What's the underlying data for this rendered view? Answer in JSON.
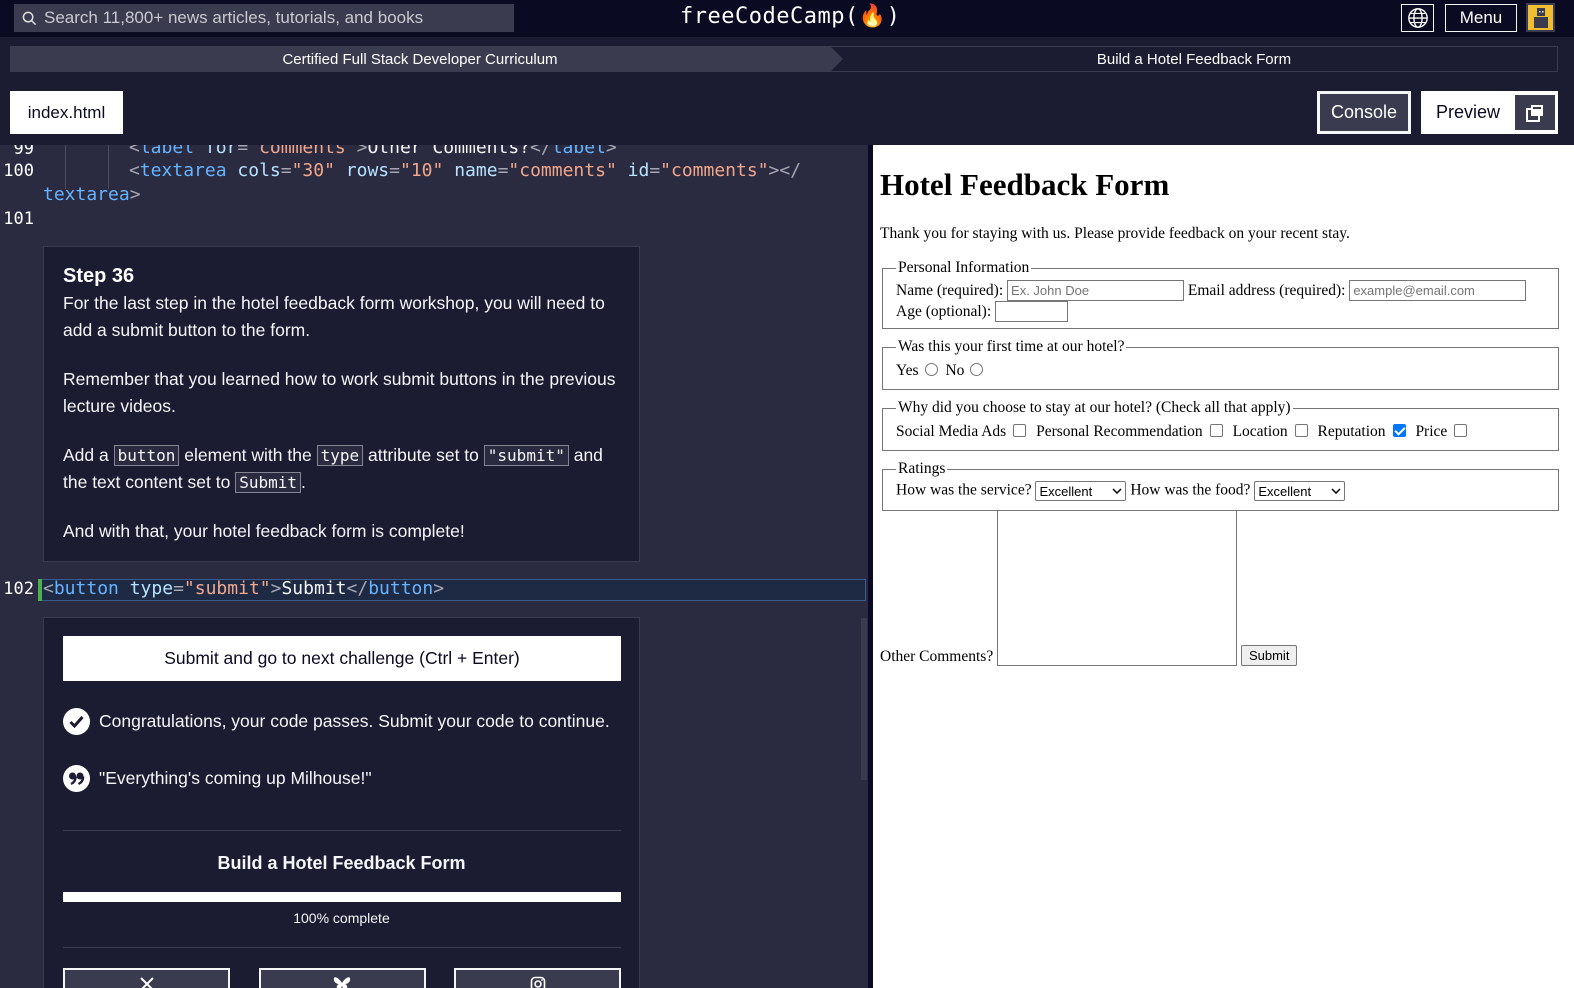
{
  "nav": {
    "search_placeholder": "Search 11,800+ news articles, tutorials, and books",
    "logo": "freeCodeCamp(🔥)",
    "menu_label": "Menu"
  },
  "breadcrumb": {
    "curriculum": "Certified Full Stack Developer Curriculum",
    "project": "Build a Hotel Feedback Form"
  },
  "tabs": {
    "file": "index.html",
    "console": "Console",
    "preview": "Preview"
  },
  "editor": {
    "line_numbers": [
      "99",
      "100",
      "101",
      "102"
    ],
    "step": {
      "title": "Step 36",
      "p1": "For the last step in the hotel feedback form workshop, you will need to add a submit button to the form.",
      "p2": "Remember that you learned how to work submit buttons in the previous lecture videos.",
      "p3_a": "Add a",
      "p3_code1": "button",
      "p3_b": "element with the",
      "p3_code2": "type",
      "p3_c": "attribute set to",
      "p3_code3": "\"submit\"",
      "p3_d": "and the text content set to",
      "p3_code4": "Submit",
      "p3_e": ".",
      "p4": "And with that, your hotel feedback form is complete!"
    },
    "result": {
      "submit_label": "Submit and go to next challenge (Ctrl + Enter)",
      "pass_msg": "Congratulations, your code passes. Submit your code to continue.",
      "quote": "\"Everything's coming up Milhouse!\"",
      "project_title": "Build a Hotel Feedback Form",
      "progress": 100,
      "progress_text": "100% complete"
    }
  },
  "preview": {
    "title": "Hotel Feedback Form",
    "intro": "Thank you for staying with us. Please provide feedback on your recent stay.",
    "personal": {
      "legend": "Personal Information",
      "name_label": "Name (required):",
      "name_placeholder": "Ex. John Doe",
      "email_label": "Email address (required):",
      "email_placeholder": "example@email.com",
      "age_label": "Age (optional):"
    },
    "first_time": {
      "legend": "Was this your first time at our hotel?",
      "yes": "Yes",
      "no": "No"
    },
    "why": {
      "legend": "Why did you choose to stay at our hotel? (Check all that apply)",
      "opt1": "Social Media Ads",
      "opt2": "Personal Recommendation",
      "opt3": "Location",
      "opt4": "Reputation",
      "opt5": "Price"
    },
    "ratings": {
      "legend": "Ratings",
      "service_label": "How was the service?",
      "service_value": "Excellent",
      "food_label": "How was the food?",
      "food_value": "Excellent"
    },
    "comments_label": "Other Comments?",
    "submit_label": "Submit"
  }
}
